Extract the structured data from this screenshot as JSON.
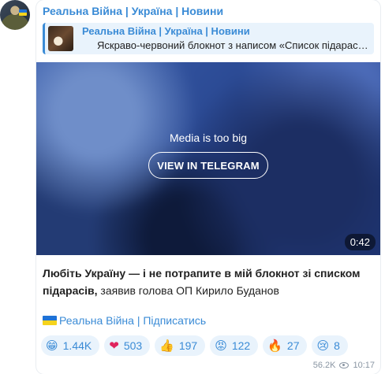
{
  "channel": {
    "name": "Реальна Війна | Україна | Новини"
  },
  "reply": {
    "title": "Реальна Війна | Україна | Новини",
    "text": "Яскраво-червоний блокнот з написом «Список підарасів»"
  },
  "media": {
    "message": "Media is too big",
    "button": "VIEW IN TELEGRAM",
    "duration": "0:42"
  },
  "post": {
    "bold": "Любіть Україну — і не потрапите в мій блокнот зі списком підарасів,",
    "rest": " заявив голова ОП Кирило Буданов",
    "subscribe": "Реальна Війна | Підписатись"
  },
  "reactions": [
    {
      "icon": "grinning-face-icon",
      "emoji": "😁",
      "count": "1.44K"
    },
    {
      "icon": "red-heart-icon",
      "emoji": "❤",
      "count": "503"
    },
    {
      "icon": "thumbs-up-icon",
      "emoji": "👍",
      "count": "197"
    },
    {
      "icon": "angry-face-icon",
      "emoji": "😡",
      "count": "122"
    },
    {
      "icon": "fire-icon",
      "emoji": "🔥",
      "count": "27"
    },
    {
      "icon": "crying-face-icon",
      "emoji": "😢",
      "count": "8"
    }
  ],
  "meta": {
    "views": "56.2K",
    "time": "10:17"
  },
  "colors": {
    "accent": "#3a8bd6",
    "reaction_bg": "#e9f3fc"
  }
}
